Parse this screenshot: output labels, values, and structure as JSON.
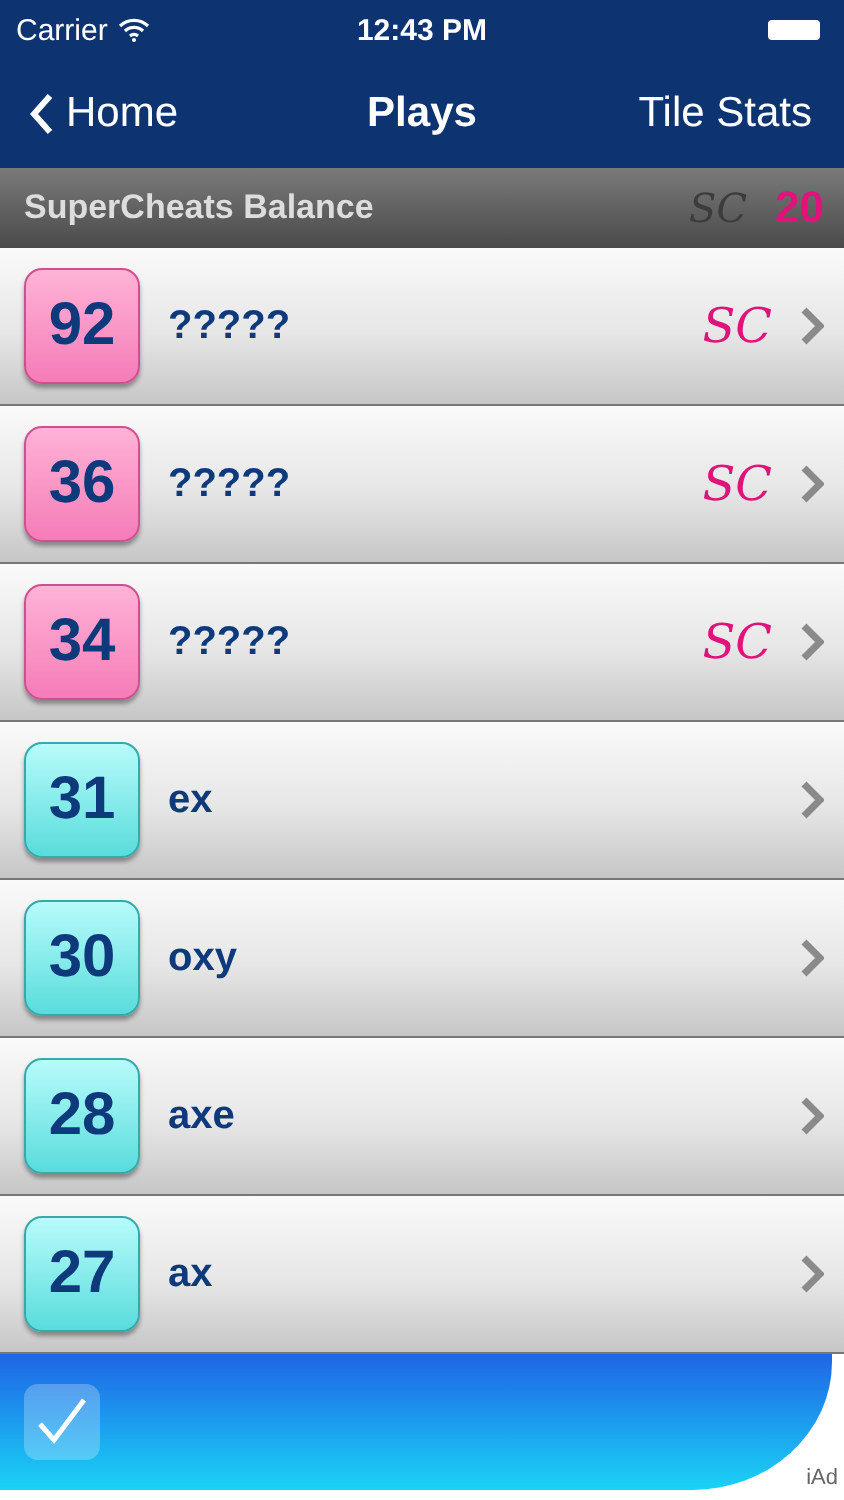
{
  "status_bar": {
    "carrier": "Carrier",
    "time": "12:43 PM"
  },
  "nav": {
    "back": "Home",
    "title": "Plays",
    "right": "Tile Stats"
  },
  "balance": {
    "label": "SuperCheats Balance",
    "logo": "SC",
    "value": "20"
  },
  "plays": [
    {
      "score": "92",
      "word": "?????",
      "kind": "locked",
      "badge": "SC"
    },
    {
      "score": "36",
      "word": "?????",
      "kind": "locked",
      "badge": "SC"
    },
    {
      "score": "34",
      "word": "?????",
      "kind": "locked",
      "badge": "SC"
    },
    {
      "score": "31",
      "word": "ex",
      "kind": "word"
    },
    {
      "score": "30",
      "word": "oxy",
      "kind": "word"
    },
    {
      "score": "28",
      "word": "axe",
      "kind": "word"
    },
    {
      "score": "27",
      "word": "ax",
      "kind": "word"
    }
  ],
  "ad": {
    "label": "iAd"
  }
}
